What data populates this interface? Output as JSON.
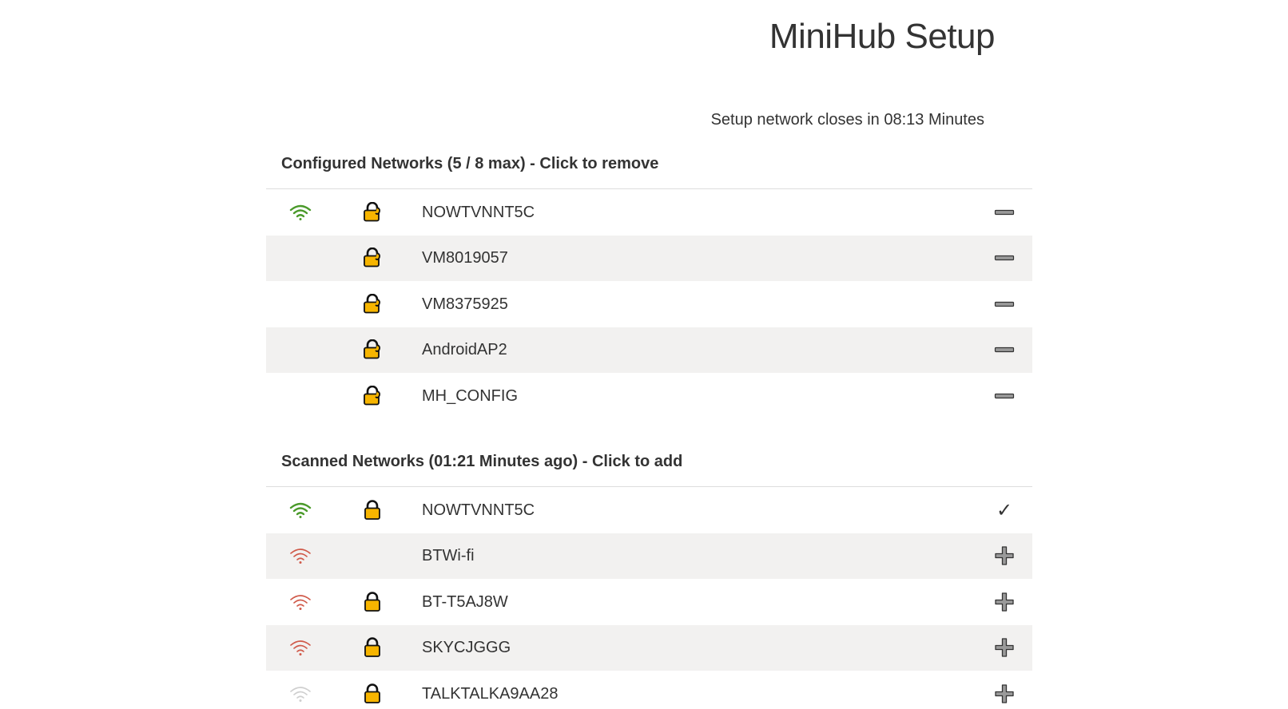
{
  "page_title": "MiniHub Setup",
  "countdown_text": "Setup network closes in 08:13 Minutes",
  "colors": {
    "signal_strong": "#4a9a2a",
    "signal_weak": "#d05a4a",
    "signal_faint": "#cfcfcf",
    "lock_fill": "#f7b500",
    "row_alt": "#f2f1f0"
  },
  "configured": {
    "heading": "Configured Networks (5 / 8 max) - Click to remove",
    "items": [
      {
        "ssid": "NOWTVNNT5C",
        "signal": "strong",
        "lock": "configured-lock-icon",
        "action": "minus-icon"
      },
      {
        "ssid": "VM8019057",
        "signal": "none",
        "lock": "configured-lock-icon",
        "action": "minus-icon"
      },
      {
        "ssid": "VM8375925",
        "signal": "none",
        "lock": "configured-lock-icon",
        "action": "minus-icon"
      },
      {
        "ssid": "AndroidAP2",
        "signal": "none",
        "lock": "configured-lock-icon",
        "action": "minus-icon"
      },
      {
        "ssid": "MH_CONFIG",
        "signal": "none",
        "lock": "configured-lock-icon",
        "action": "minus-icon"
      }
    ]
  },
  "scanned": {
    "heading": "Scanned Networks (01:21 Minutes ago) - Click to add",
    "items": [
      {
        "ssid": "NOWTVNNT5C",
        "signal": "strong",
        "lock": "lock-icon",
        "action": "check-icon"
      },
      {
        "ssid": "BTWi-fi",
        "signal": "weak",
        "lock": "none",
        "action": "plus-icon"
      },
      {
        "ssid": "BT-T5AJ8W",
        "signal": "weak",
        "lock": "lock-icon",
        "action": "plus-icon"
      },
      {
        "ssid": "SKYCJGGG",
        "signal": "weak",
        "lock": "lock-icon",
        "action": "plus-icon"
      },
      {
        "ssid": "TALKTALKA9AA28",
        "signal": "faint",
        "lock": "lock-icon",
        "action": "plus-icon"
      }
    ]
  }
}
